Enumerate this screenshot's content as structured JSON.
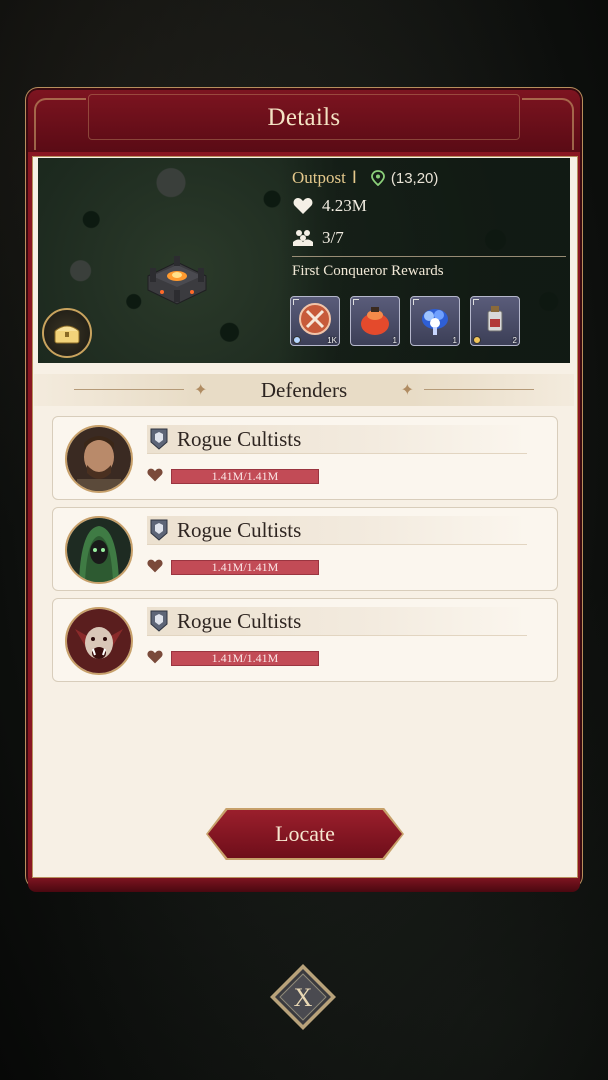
{
  "header": {
    "title": "Details"
  },
  "outpost": {
    "name": "Outpost",
    "level": "Ⅰ",
    "coords": "(13,20)",
    "hp": "4.23M",
    "troops": "3/7"
  },
  "rewards": {
    "title": "First Conqueror Rewards",
    "items": [
      {
        "icon": "crossed-swords-icon",
        "qty": "1K"
      },
      {
        "icon": "red-gem-bag-icon",
        "qty": "1"
      },
      {
        "icon": "blue-crystal-icon",
        "qty": "1"
      },
      {
        "icon": "potion-bottle-icon",
        "qty": "2"
      }
    ]
  },
  "defenders": {
    "title": "Defenders",
    "list": [
      {
        "name": "Rogue Cultists",
        "hp": "1.41M/1.41M",
        "hp_fraction": 1.0
      },
      {
        "name": "Rogue Cultists",
        "hp": "1.41M/1.41M",
        "hp_fraction": 1.0
      },
      {
        "name": "Rogue Cultists",
        "hp": "1.41M/1.41M",
        "hp_fraction": 1.0
      }
    ]
  },
  "actions": {
    "locate": "Locate",
    "close": "X"
  },
  "colors": {
    "accent": "#8a1622",
    "gold": "#c7a06a",
    "parchment": "#f7f0e5",
    "hp": "#c24b56"
  }
}
